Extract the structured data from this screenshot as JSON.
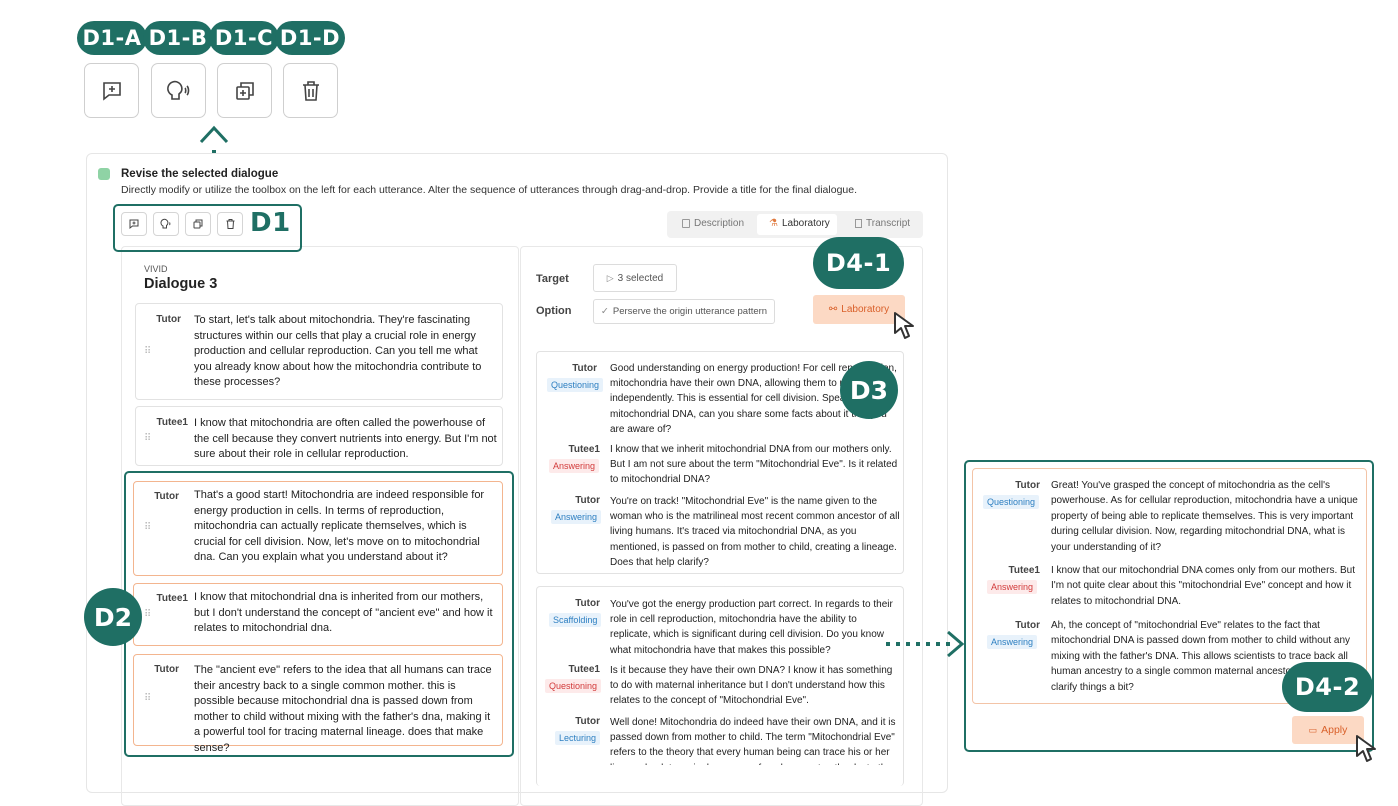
{
  "toolbox_labels": {
    "a": "D1-A",
    "b": "D1-B",
    "c": "D1-C",
    "d": "D1-D"
  },
  "icons": {
    "add": "comment-plus-icon",
    "voice": "speak-icon",
    "dup": "duplicate-icon",
    "del": "trash-icon"
  },
  "panel": {
    "title": "Revise the selected dialogue",
    "subtitle": "Directly modify or utilize the toolbox on the left for each utterance. Alter the sequence of utterances through drag-and-drop. Provide a title for the final dialogue."
  },
  "labels": {
    "d1": "D1",
    "d2": "D2",
    "d3": "D3",
    "d41": "D4-1",
    "d42": "D4-2"
  },
  "tabs": {
    "description": "Description",
    "laboratory": "Laboratory",
    "transcript": "Transcript"
  },
  "dialogue": {
    "source": "VIVID",
    "title": "Dialogue 3",
    "utterances": [
      {
        "speaker": "Tutor",
        "text": "To start, let's talk about mitochondria. They're fascinating structures within our cells that play a crucial role in energy production and cellular reproduction. Can you tell me what you already know about how the mitochondria contribute to these processes?"
      },
      {
        "speaker": "Tutee1",
        "text": "I know that mitochondria are often called the powerhouse of the cell because they convert nutrients into energy. But I'm not sure about their role in cellular reproduction."
      },
      {
        "speaker": "Tutor",
        "text": "That's a good start! Mitochondria are indeed responsible for energy production in cells. In terms of reproduction, mitochondria can actually replicate themselves, which is crucial for cell division. Now, let's move on to mitochondrial dna. Can you explain what you understand about it?"
      },
      {
        "speaker": "Tutee1",
        "text": "I know that mitochondrial dna is inherited from our mothers, but I don't understand the concept of \"ancient eve\" and how it relates to mitochondrial dna."
      },
      {
        "speaker": "Tutor",
        "text": "The \"ancient eve\" refers to the idea that all humans can trace their ancestry back to a single common mother. this is possible because mitochondrial dna is passed down from mother to child without mixing with the father's dna, making it a powerful tool for tracing maternal lineage. does that make sense?"
      }
    ]
  },
  "lab": {
    "target_label": "Target",
    "target_value": "3 selected",
    "option_label": "Option",
    "option_value": "Perserve the origin utterance pattern",
    "button": "Laboratory",
    "results": [
      {
        "items": [
          {
            "speaker": "Tutor",
            "tag": "Questioning",
            "text": "Good understanding on energy production! For cell reproduction, mitochondria have their own DNA, allowing them to replicate independently. This is essential for cell division. Speaking of mitochondrial DNA, can you share some facts about it that you are aware of?"
          },
          {
            "speaker": "Tutee1",
            "tag": "Answering",
            "text": "I know that we inherit mitochondrial DNA from our mothers only. But I am not sure about the term \"Mitochondrial Eve\". Is it related to mitochondrial DNA?"
          },
          {
            "speaker": "Tutor",
            "tag": "Answering",
            "text": "You're on track! \"Mitochondrial Eve\" is the name given to the woman who is the matrilineal most recent common ancestor of all living humans. It's traced via mitochondrial DNA, as you mentioned, is passed on from mother to child, creating a lineage. Does that help clarify?"
          }
        ]
      },
      {
        "items": [
          {
            "speaker": "Tutor",
            "tag": "Scaffolding",
            "text": "You've got the energy production part correct. In regards to their role in cell reproduction, mitochondria have the ability to replicate, which is significant during cell division. Do you know what mitochondria have that makes this possible?"
          },
          {
            "speaker": "Tutee1",
            "tag": "Questioning",
            "text": "Is it because they have their own DNA? I know it has something to do with maternal inheritance but I don't understand how this relates to the concept of \"Mitochondrial Eve\"."
          },
          {
            "speaker": "Tutor",
            "tag": "Lecturing",
            "text": "Well done! Mitochondria do indeed have their own DNA, and it is passed down from mother to child. The term \"Mitochondrial Eve\" refers to the theory that every human being can trace his or her lineage back to a single common female ancestor, thanks to the"
          }
        ]
      }
    ]
  },
  "result_panel": {
    "items": [
      {
        "speaker": "Tutor",
        "tag": "Questioning",
        "text": "Great! You've grasped the concept of mitochondria as the cell's powerhouse. As for cellular reproduction, mitochondria have a unique property of being able to replicate themselves. This is very important during cellular division. Now, regarding mitochondrial DNA, what is your understanding of it?"
      },
      {
        "speaker": "Tutee1",
        "tag": "Answering",
        "text": "I know that our mitochondrial DNA comes only from our mothers. But I'm not quite clear about this \"mitochondrial Eve\" concept and how it relates to mitochondrial DNA."
      },
      {
        "speaker": "Tutor",
        "tag": "Answering",
        "text": "Ah, the concept of \"mitochondrial Eve\" relates to the fact that mitochondrial DNA is passed down from mother to child without any mixing with the father's DNA. This allows scientists to trace back all human ancestry to a single common maternal ancestor. Does that clarify things a bit?"
      }
    ],
    "apply": "Apply"
  },
  "colors": {
    "accent": "#1f6f64",
    "orange": "#f3b58f",
    "lab_btn": "#fcd9c4"
  }
}
